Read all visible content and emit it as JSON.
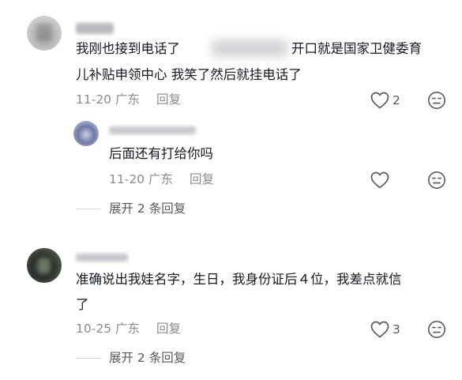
{
  "comments": [
    {
      "line1_a": "我刚也接到电话了",
      "line1_b": "开口就是国家卫健委育",
      "line2": "儿补贴申领中心 我笑了然后就挂电话了",
      "date": "11-20",
      "location": "广东",
      "reply_label": "回复",
      "likes": "2",
      "icons": [
        "heart-outline-icon",
        "meh-face-icon"
      ]
    },
    {
      "text": "后面还有打给你吗",
      "date": "11-20",
      "location": "广东",
      "reply_label": "回复",
      "likes": "",
      "icons": [
        "heart-outline-icon",
        "meh-face-icon"
      ]
    },
    {
      "line1": "准确说出我娃名字，生日，我身份证后４位，我差点就信",
      "line2": "了",
      "date": "10-25",
      "location": "广东",
      "reply_label": "回复",
      "likes": "3",
      "icons": [
        "heart-outline-icon",
        "meh-face-icon"
      ]
    }
  ],
  "expand_replies": [
    "展开 2 条回复",
    "展开 2 条回复"
  ],
  "colors": {
    "text": "#161823",
    "meta": "#8a8b91",
    "icon": "#585a60"
  }
}
